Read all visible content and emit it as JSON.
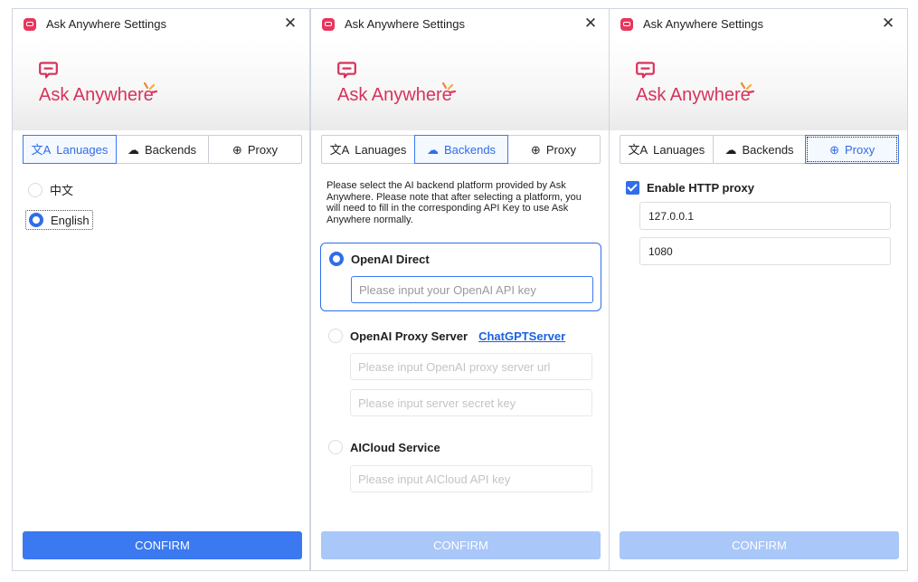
{
  "windows": [
    {
      "title": "Ask Anywhere Settings",
      "brand": "Ask Anywhere",
      "tabs": [
        "Lanuages",
        "Backends",
        "Proxy"
      ],
      "active_tab": "Lanuages",
      "languages": [
        "中文",
        "English"
      ],
      "selected_language": "English",
      "confirm_label": "CONFIRM",
      "confirm_enabled": true
    },
    {
      "title": "Ask Anywhere Settings",
      "brand": "Ask Anywhere",
      "tabs": [
        "Lanuages",
        "Backends",
        "Proxy"
      ],
      "active_tab": "Backends",
      "description": "Please select the AI backend platform provided by Ask Anywhere. Please note that after selecting a platform, you will need to fill in the corresponding API Key to use Ask Anywhere normally.",
      "options": [
        {
          "label": "OpenAI Direct",
          "selected": true,
          "fields": [
            {
              "placeholder": "Please input your OpenAI API key"
            }
          ]
        },
        {
          "label": "OpenAI Proxy Server",
          "link": "ChatGPTServer",
          "selected": false,
          "fields": [
            {
              "placeholder": "Please input OpenAI proxy server url"
            },
            {
              "placeholder": "Please input server secret key"
            }
          ]
        },
        {
          "label": "AICloud Service",
          "selected": false,
          "fields": [
            {
              "placeholder": "Please input AICloud API key"
            }
          ]
        }
      ],
      "confirm_label": "CONFIRM",
      "confirm_enabled": false
    },
    {
      "title": "Ask Anywhere Settings",
      "brand": "Ask Anywhere",
      "tabs": [
        "Lanuages",
        "Backends",
        "Proxy"
      ],
      "active_tab": "Proxy",
      "enable_proxy_label": "Enable HTTP proxy",
      "enable_proxy": true,
      "proxy_host": "127.0.0.1",
      "proxy_port": "1080",
      "confirm_label": "CONFIRM",
      "confirm_enabled": false
    }
  ],
  "colors": {
    "brand": "#d9315a",
    "accent": "#2f6ee8",
    "confirm_disabled": "#a9c7f8"
  },
  "icons": {
    "app": "chat-bubble-icon",
    "languages": "translate-icon",
    "backends": "cloud-icon",
    "proxy": "globe-icon",
    "close": "close-icon"
  }
}
